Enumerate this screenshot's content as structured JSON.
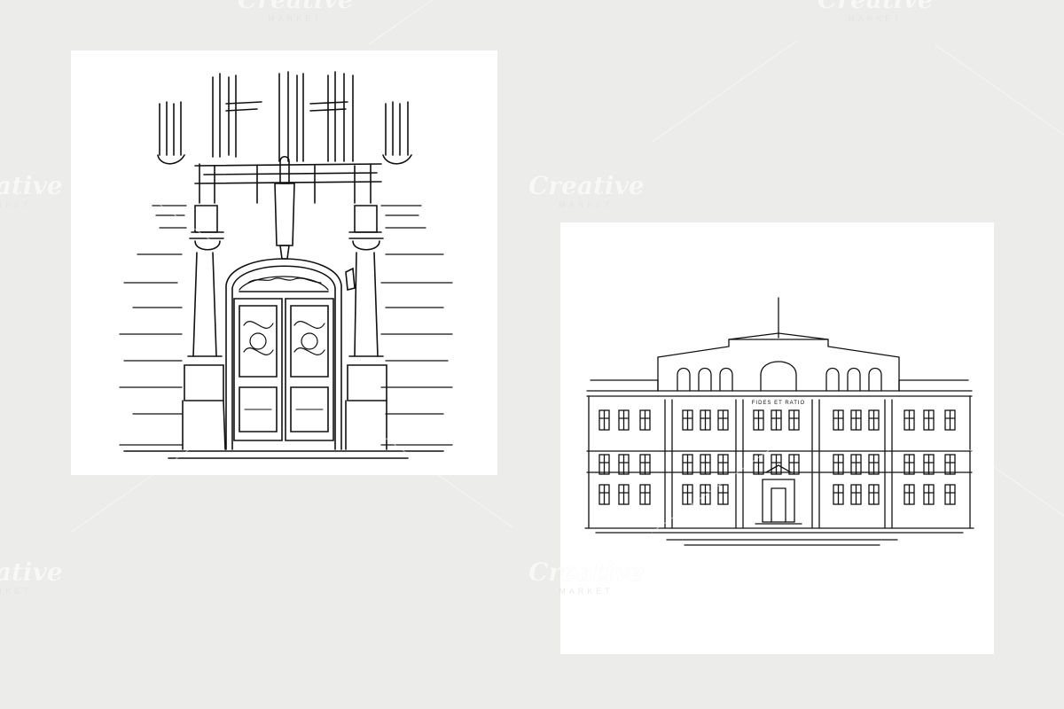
{
  "background_color": "#ececea",
  "card_color": "#ffffff",
  "line_color": "#111111",
  "watermark": {
    "brand": "Creative",
    "sub": "MARKET"
  },
  "building_inscription": "FIDES ET RATIO"
}
